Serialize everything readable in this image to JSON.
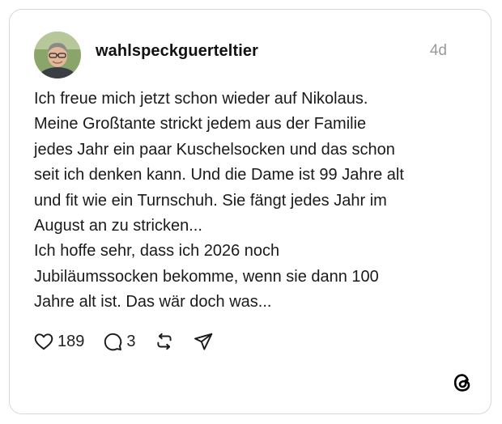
{
  "post": {
    "username": "wahlspeckguerteltier",
    "time": "4d",
    "lines": [
      "Ich freue mich jetzt schon wieder auf Nikolaus.",
      "Meine Großtante strickt jedem aus der Familie",
      "jedes Jahr ein paar Kuschelsocken und das schon",
      "seit ich denken kann. Und die Dame ist 99 Jahre alt",
      "und fit wie ein Turnschuh. Sie fängt jedes Jahr im",
      "August an zu stricken...",
      "Ich hoffe sehr, dass ich 2026 noch",
      "Jubiläumssocken bekomme, wenn sie dann 100",
      "Jahre alt ist. Das wär doch was..."
    ],
    "likes": "189",
    "comments": "3"
  },
  "icons": {
    "like": "heart-icon",
    "comment": "comment-bubble-icon",
    "repost": "repost-icon",
    "share": "send-icon",
    "brand": "threads-logo-icon"
  }
}
